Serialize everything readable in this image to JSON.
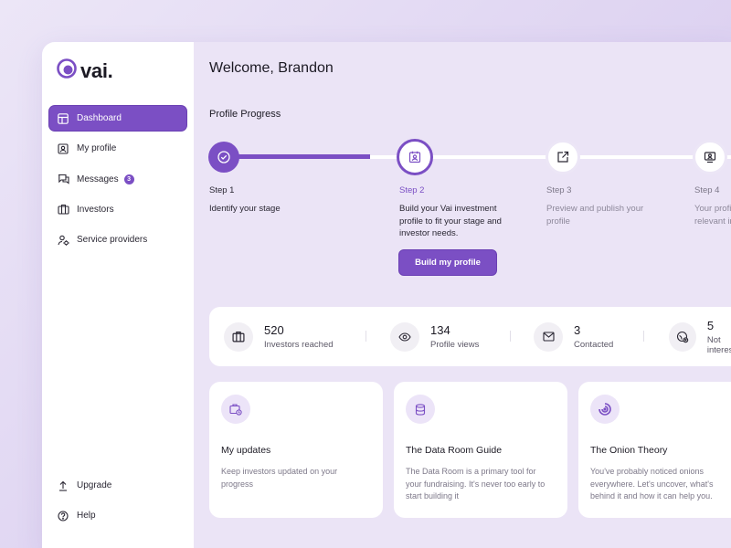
{
  "app": {
    "logo_text": "vai."
  },
  "sidebar": {
    "items": [
      {
        "label": "Dashboard",
        "icon": "dashboard-icon",
        "active": true
      },
      {
        "label": "My profile",
        "icon": "profile-icon"
      },
      {
        "label": "Messages",
        "icon": "messages-icon",
        "badge": "3"
      },
      {
        "label": "Investors",
        "icon": "briefcase-icon"
      },
      {
        "label": "Service providers",
        "icon": "service-providers-icon"
      }
    ],
    "bottom": [
      {
        "label": "Upgrade",
        "icon": "upgrade-icon"
      },
      {
        "label": "Help",
        "icon": "help-icon"
      }
    ]
  },
  "main": {
    "welcome": "Welcome, Brandon",
    "progress_title": "Profile Progress",
    "steps": [
      {
        "label": "Step 1",
        "desc": "Identify your stage",
        "state": "done",
        "icon": "check-icon"
      },
      {
        "label": "Step 2",
        "desc": "Build your Vai investment profile to fit your stage and investor needs.",
        "state": "current",
        "icon": "profile-card-icon"
      },
      {
        "label": "Step 3",
        "desc": "Preview and publish your profile",
        "state": "future",
        "icon": "publish-icon"
      },
      {
        "label": "Step 4",
        "desc": "Your profile is presented to relevant investors",
        "state": "future",
        "icon": "present-icon"
      }
    ],
    "build_button": "Build my profile",
    "stats": [
      {
        "value": "520",
        "label": "Investors reached",
        "icon": "briefcase-icon"
      },
      {
        "value": "134",
        "label": "Profile views",
        "icon": "eye-icon"
      },
      {
        "value": "3",
        "label": "Contacted",
        "icon": "mail-icon"
      },
      {
        "value": "5",
        "label": "Not interested",
        "icon": "not-interested-icon"
      }
    ],
    "cards": [
      {
        "title": "My updates",
        "desc": "Keep investors updated on your progress",
        "icon": "updates-icon"
      },
      {
        "title": "The Data Room Guide",
        "desc": "The Data Room is a primary tool for your fundraising. It's never too early to start building it",
        "icon": "database-icon"
      },
      {
        "title": "The Onion Theory",
        "desc": "You've probably noticed onions everywhere. Let's uncover, what's behind it and how it can help you.",
        "icon": "onion-icon"
      }
    ]
  },
  "colors": {
    "accent": "#7b4fc4",
    "background": "#ebe4f6",
    "sidebar": "#ffffff"
  }
}
